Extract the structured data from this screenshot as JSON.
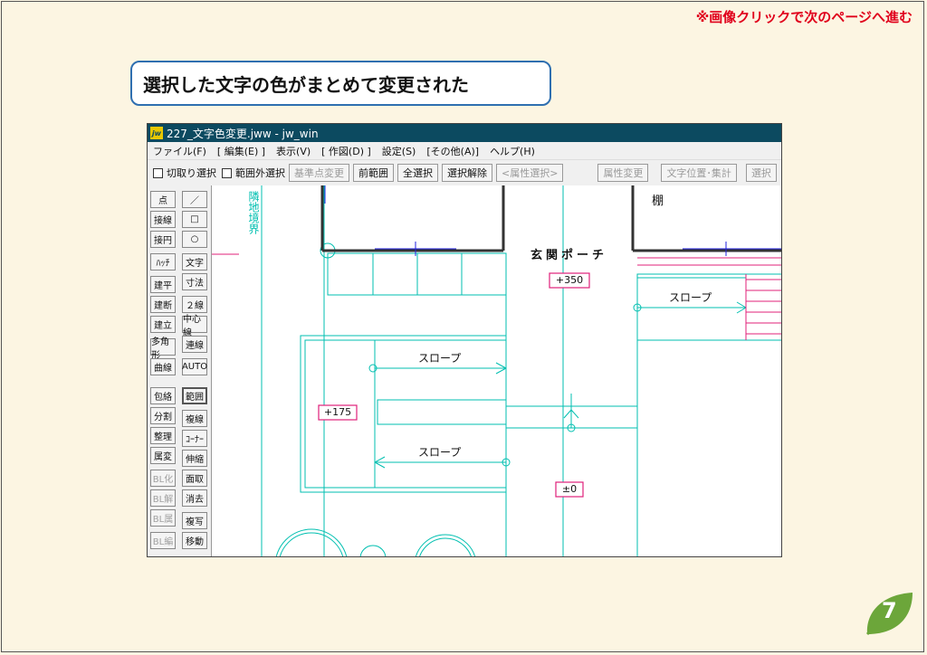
{
  "nav_note": "※画像クリックで次のページへ進む",
  "caption": "選択した文字の色がまとめて変更された",
  "window": {
    "title": "227_文字色変更.jww - jw_win",
    "menu": [
      "ファイル(F)",
      "[ 編集(E) ]",
      "表示(V)",
      "[ 作図(D) ]",
      "設定(S)",
      "[その他(A)]",
      "ヘルプ(H)"
    ],
    "toolbar": {
      "chk_cut": "切取り選択",
      "chk_out": "範囲外選択",
      "base": "基準点変更",
      "prev": "前範囲",
      "all": "全選択",
      "clear": "選択解除",
      "attr_sel": "<属性選択>",
      "attr_change": "属性変更",
      "text_pos": "文字位置･集計",
      "more": "選択"
    },
    "left_col1": [
      "点",
      "接線",
      "接円",
      "ﾊｯﾁ",
      "建平",
      "建断",
      "建立",
      "多角形",
      "曲線",
      "包絡",
      "分割",
      "整理",
      "属変",
      "BL化",
      "BL解",
      "BL属",
      "BL編"
    ],
    "left_col2": [
      "／",
      "□",
      "○",
      "文字",
      "寸法",
      "２線",
      "中心線",
      "連線",
      "AUTO",
      "範囲",
      "複線",
      "ｺｰﾅｰ",
      "伸縮",
      "面取",
      "消去",
      "複写",
      "移動"
    ],
    "drawing": {
      "boundary": "隣地境界",
      "shelf": "棚",
      "porch": "玄関ポーチ",
      "level_350": "+350",
      "level_175": "+175",
      "level_0": "±0",
      "slope_1": "スロープ",
      "slope_2": "スロープ",
      "slope_3": "スロープ"
    }
  },
  "page_number": "7",
  "colors": {
    "accent": "#e0001b",
    "cad_line": "#00bfb0",
    "pink": "#e0207a",
    "blue": "#2020e0",
    "leaf": "#6ca63a"
  }
}
